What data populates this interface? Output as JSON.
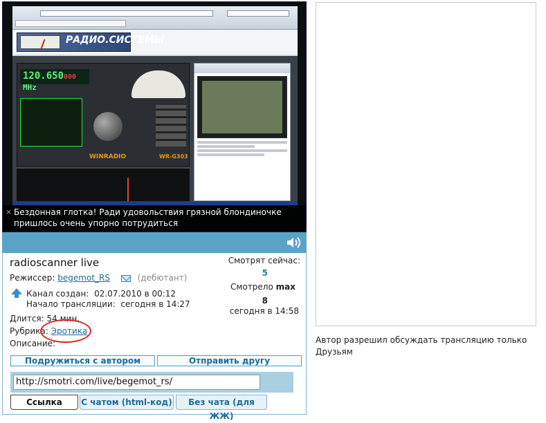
{
  "player": {
    "scanner": {
      "freq_main": "120.650",
      "freq_suffix": "000",
      "freq_unit": "MHz",
      "brand": "WINRADIO",
      "model": "WR-G303"
    },
    "site_logo_text": "РАДИО.СИСТЕМЫ",
    "caption_close": "×",
    "caption": "Бездонная глотка! Ради удовольствия грязной блондиночке пришлось очень упорно потрудиться"
  },
  "channel": {
    "title": "radioscanner live",
    "director_label": "Режиссер:",
    "director_name": "begemot_RS",
    "director_rank": "(дебютант)",
    "created_label": "Канал создан:",
    "created_value": "02.07.2010 в 00:12",
    "start_label": "Начало трансляции:",
    "start_value": "сегодня в 14:27",
    "lasts": "Длится: 54 мин.",
    "rubric_label": "Рубрика:",
    "rubric_value": "Эротика",
    "description_label": "Описание:",
    "now_watching_label": "Смотрят сейчас:",
    "now_watching_value": "5",
    "watched_label": "Смотрело",
    "watched_max": "max",
    "watched_value": "8",
    "watched_time": "сегодня в 14:58"
  },
  "buttons": {
    "befriend": "Подружиться с автором",
    "send_friend": "Отправить другу"
  },
  "embed": {
    "url": "http://smotri.com/live/begemot_rs/",
    "tabs": [
      "Ссылка",
      "С чатом (html-код)",
      "Без чата (для ЖЖ)"
    ]
  },
  "side": {
    "note": "Автор разрешил обсуждать трансляцию только Друзьям"
  },
  "icons": {
    "speaker": "speaker-icon",
    "mail": "mail-icon",
    "arrow": "arrow-up-icon"
  },
  "colors": {
    "accent": "#5aa3c4",
    "link": "#1b6b9a",
    "highlight": "#d22222"
  }
}
